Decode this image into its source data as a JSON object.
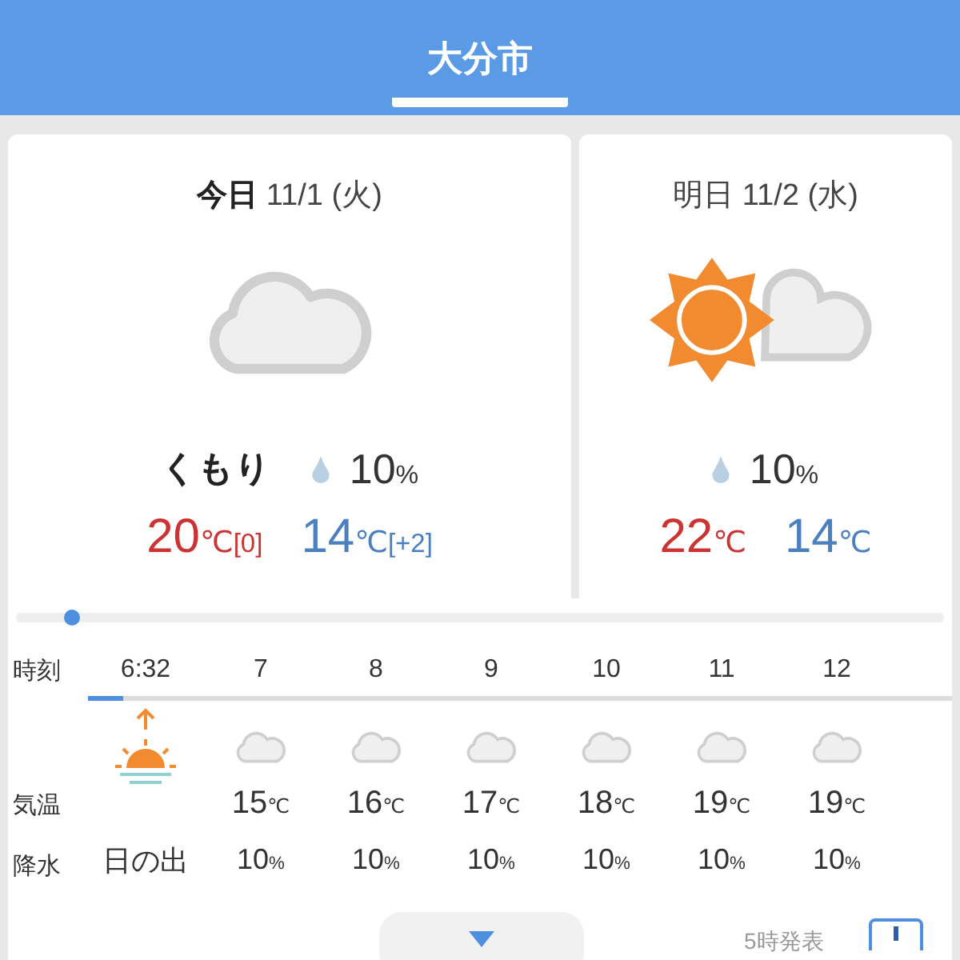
{
  "header": {
    "title": "大分市"
  },
  "days": [
    {
      "day": "今日",
      "date": "11/1 (火)",
      "selected": true,
      "kind": "cloudy",
      "weather": "くもり",
      "rain": "10",
      "rain_unit": "%",
      "high": "20",
      "high_unit": "℃",
      "high_diff": "[0]",
      "low": "14",
      "low_unit": "℃",
      "low_diff": "[+2]"
    },
    {
      "day": "明日",
      "date": "11/2 (水)",
      "selected": false,
      "kind": "sunny_cloudy",
      "rain": "10",
      "rain_unit": "%",
      "high": "22",
      "high_unit": "℃",
      "low": "14",
      "low_unit": "℃"
    }
  ],
  "hourly": {
    "labels": {
      "time": "時刻",
      "temp": "気温",
      "rain": "降水"
    },
    "progress": {
      "level": 0.04
    },
    "columns": [
      {
        "kind": "sunrise",
        "time": "6:32",
        "note": "日の出"
      },
      {
        "kind": "cloudy",
        "time": "7",
        "temp": "15",
        "temp_unit": "℃",
        "rain": "10",
        "rain_unit": "%"
      },
      {
        "kind": "cloudy",
        "time": "8",
        "temp": "16",
        "temp_unit": "℃",
        "rain": "10",
        "rain_unit": "%"
      },
      {
        "kind": "cloudy",
        "time": "9",
        "temp": "17",
        "temp_unit": "℃",
        "rain": "10",
        "rain_unit": "%"
      },
      {
        "kind": "cloudy",
        "time": "10",
        "temp": "18",
        "temp_unit": "℃",
        "rain": "10",
        "rain_unit": "%"
      },
      {
        "kind": "cloudy",
        "time": "11",
        "temp": "19",
        "temp_unit": "℃",
        "rain": "10",
        "rain_unit": "%"
      },
      {
        "kind": "cloudy",
        "time": "12",
        "temp": "19",
        "temp_unit": "℃",
        "rain": "10",
        "rain_unit": "%"
      }
    ]
  },
  "footer": {
    "issued": "5時発表"
  }
}
